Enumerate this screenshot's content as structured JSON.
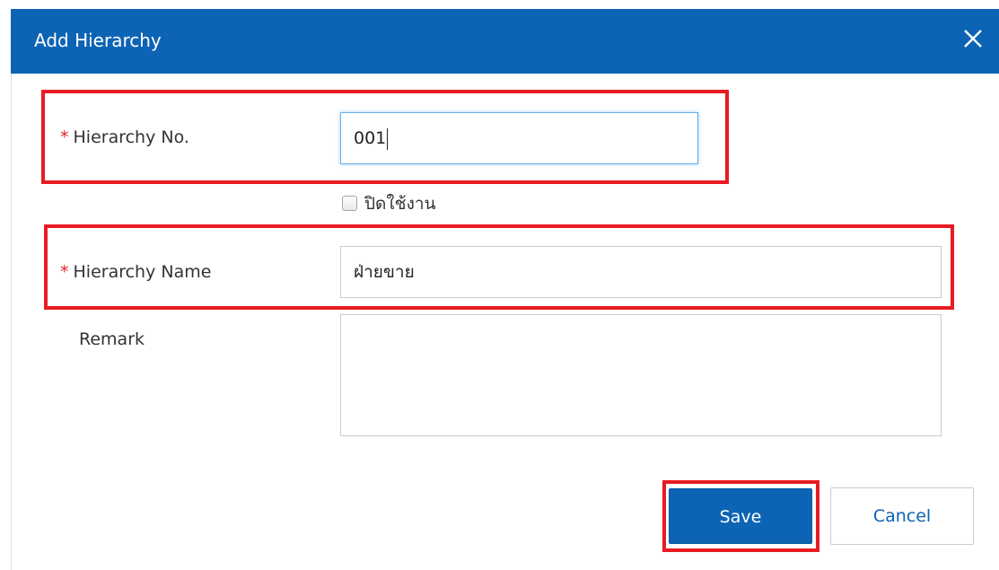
{
  "dialog": {
    "title": "Add Hierarchy",
    "close_icon": "close-icon"
  },
  "form": {
    "hierarchy_no": {
      "required_mark": "*",
      "label": "Hierarchy No.",
      "value": "001"
    },
    "disable_checkbox": {
      "label": "ปิดใช้งาน",
      "checked": false
    },
    "hierarchy_name": {
      "required_mark": "*",
      "label": "Hierarchy Name",
      "value": "ฝ่ายขาย"
    },
    "remark": {
      "label": "Remark",
      "value": ""
    }
  },
  "buttons": {
    "save_label": "Save",
    "cancel_label": "Cancel"
  },
  "colors": {
    "header": "#0d64b4",
    "required": "#e0262c",
    "highlight": "#e81b23",
    "focus": "#66afe9"
  }
}
